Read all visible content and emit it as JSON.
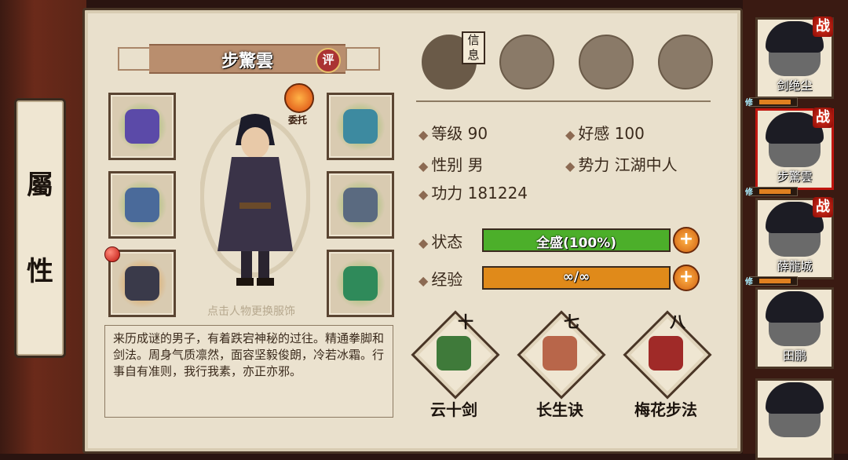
{
  "side_tab": {
    "char1": "屬",
    "char2": "性"
  },
  "character": {
    "name": "步驚雲",
    "eval_label": "评",
    "delegate_label": "委托",
    "avatar_hint": "点击人物更换服饰",
    "bio": "来历成谜的男子，有着跌宕神秘的过往。精通拳脚和剑法。周身气质凛然，面容坚毅俊朗，冷若冰霜。行事自有准则，我行我素，亦正亦邪。"
  },
  "equipment": [
    {
      "name": "boots-item",
      "glow": "#7fb84a",
      "color": "#5b4aa8"
    },
    {
      "name": "helmet-item",
      "glow": "#7fb84a",
      "color": "#3d8aa0"
    },
    {
      "name": "sword-item",
      "glow": "#7fb84a",
      "color": "#4a6a9a"
    },
    {
      "name": "armor-item",
      "glow": "#7fb84a",
      "color": "#5a6a80"
    },
    {
      "name": "ring-item",
      "glow": "#e0902a",
      "color": "#3a3a4a"
    },
    {
      "name": "jade-pendant-item",
      "glow": "#7fb84a",
      "color": "#2f8a5a"
    }
  ],
  "tabs": {
    "info_label": "信息",
    "items": [
      "info-tab",
      "scroll-map-tab",
      "bagua-tab",
      "meridian-tab"
    ]
  },
  "stats": {
    "level_label": "等级",
    "level": "90",
    "favor_label": "好感",
    "favor": "100",
    "gender_label": "性别",
    "gender": "男",
    "faction_label": "势力",
    "faction": "江湖中人",
    "power_label": "功力",
    "power": "181224"
  },
  "status_bar": {
    "label": "状态",
    "text": "全盛(100%)",
    "value": 1.0,
    "color": "#4caf2a"
  },
  "exp_bar": {
    "label": "经验",
    "text": "∞/∞",
    "value": 1.0,
    "color": "#e08a1a"
  },
  "skills": [
    {
      "name": "云十剑",
      "level": "十",
      "color": "#3f7a3a"
    },
    {
      "name": "长生诀",
      "level": "七",
      "color": "#b8664a"
    },
    {
      "name": "梅花步法",
      "level": "八",
      "color": "#a02a28"
    }
  ],
  "roster": [
    {
      "name": "剑绝尘",
      "battle": "战",
      "selected": false,
      "xiu": "修"
    },
    {
      "name": "步驚雲",
      "battle": "战",
      "selected": true,
      "xiu": "修"
    },
    {
      "name": "薛龍城",
      "battle": "战",
      "selected": false,
      "xiu": "修"
    },
    {
      "name": "田鹏",
      "battle": "",
      "selected": false,
      "xiu": ""
    },
    {
      "name": "",
      "battle": "",
      "selected": false,
      "xiu": ""
    }
  ]
}
